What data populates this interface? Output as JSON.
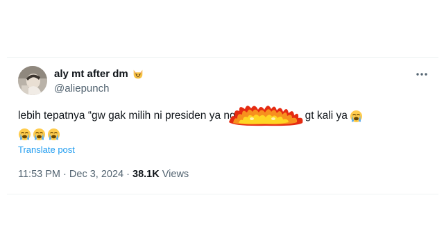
{
  "tweet": {
    "author": {
      "display_name": "aly mt after dm",
      "display_name_emoji": "pouting-cat-emoji",
      "handle": "@aliepunch",
      "avatar_icon": "avatar-photo"
    },
    "more_icon": "more-dots-icon",
    "text_line1_before": "lebih tepatnya “gw gak milih ni presiden ya ng",
    "text_line1_after": "gt kali ya",
    "censor_icon": "fire-censor-sticker",
    "emoji": "loudly-crying-face-emoji",
    "translate_label": "Translate post",
    "time": "11:53 PM",
    "separator": "·",
    "date": "Dec 3, 2024",
    "views_count": "38.1K",
    "views_label": "Views"
  },
  "colors": {
    "text_primary": "#0f1419",
    "text_secondary": "#536471",
    "link_blue": "#1d9bf0",
    "divider": "#eff3f4"
  }
}
